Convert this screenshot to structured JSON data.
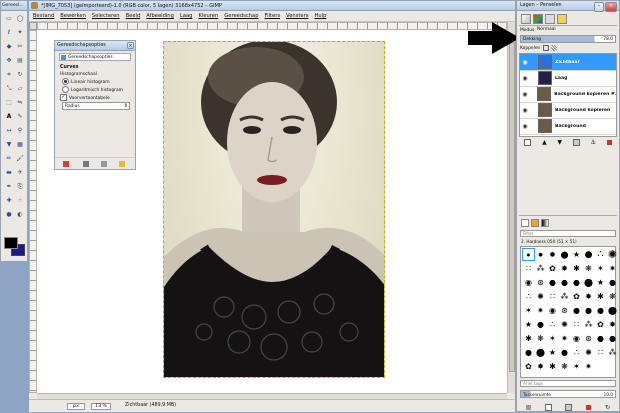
{
  "main_window": {
    "title": "*[IMG_7053] (geïmporteerd)-1.0 (RGB color, 5 lagen) 3168x4752 – GIMP",
    "menus": [
      "Bestand",
      "Bewerken",
      "Selecteren",
      "Beeld",
      "Afbeelding",
      "Laag",
      "Kleuren",
      "Gereedschap",
      "Filters",
      "Vensters",
      "Hulp"
    ],
    "status": {
      "unit": "px",
      "zoom": "13 %",
      "text": "Zichtbaar (489,9 MB)"
    }
  },
  "toolbox": {
    "title": "Gereed...",
    "tools": [
      "rect-select",
      "ellipse-select",
      "lasso",
      "fuzzy-select",
      "color-select",
      "scissors",
      "move",
      "align",
      "crop",
      "rotate",
      "scale",
      "shear",
      "perspective",
      "flip",
      "text",
      "color-picker",
      "measure",
      "zoom",
      "paint-bucket",
      "blend",
      "pencil",
      "paintbrush",
      "eraser",
      "airbrush",
      "ink",
      "clone",
      "heal",
      "smudge",
      "blur",
      "dodge"
    ],
    "fg_color": "#000000",
    "bg_color": "#1a1a8a"
  },
  "tool_options": {
    "title": "Gereedschapsopties",
    "tab_label": "Gereedschapsopties",
    "heading": "Curves",
    "histogram_label": "Histogramschaal",
    "linear_label": "Lineair histogram",
    "log_label": "Logaritmisch histogram",
    "preview_label": "Voorvertoontabele",
    "dropdown_value": "Radius"
  },
  "layers_dialog": {
    "title": "Lagen – Penselen",
    "mode_label": "Modus",
    "mode_value": "Normaal",
    "opacity_label": "Dekking",
    "opacity_value": "78.0",
    "lock_label": "Koppelen",
    "layers": [
      {
        "name": "Zichtbaar",
        "selected": true,
        "thumb_color": "#2f6fd6"
      },
      {
        "name": "Laag",
        "selected": false,
        "thumb_color": "#24204a"
      },
      {
        "name": "Background kopiëren #1",
        "selected": false,
        "thumb_color": "#6b5a4a"
      },
      {
        "name": "Background kopiëren",
        "selected": false,
        "thumb_color": "#6b5a4a"
      },
      {
        "name": "Background",
        "selected": false,
        "thumb_color": "#6b5a4a"
      }
    ],
    "brush_filter": "Filter",
    "brush_name": "2. Hardness 050 (51 × 51)",
    "brush_tag_placeholder": "Ariel tags",
    "brush_spacing_label": "Tussenruimte",
    "brush_spacing_value": "10.0"
  },
  "colors": {
    "accent": "#3399ff",
    "desktop": "#8ea4c4",
    "titlebar": "#c9d9ee",
    "panel_bg": "#ece9e4",
    "canvas_bg": "#ffffff"
  }
}
